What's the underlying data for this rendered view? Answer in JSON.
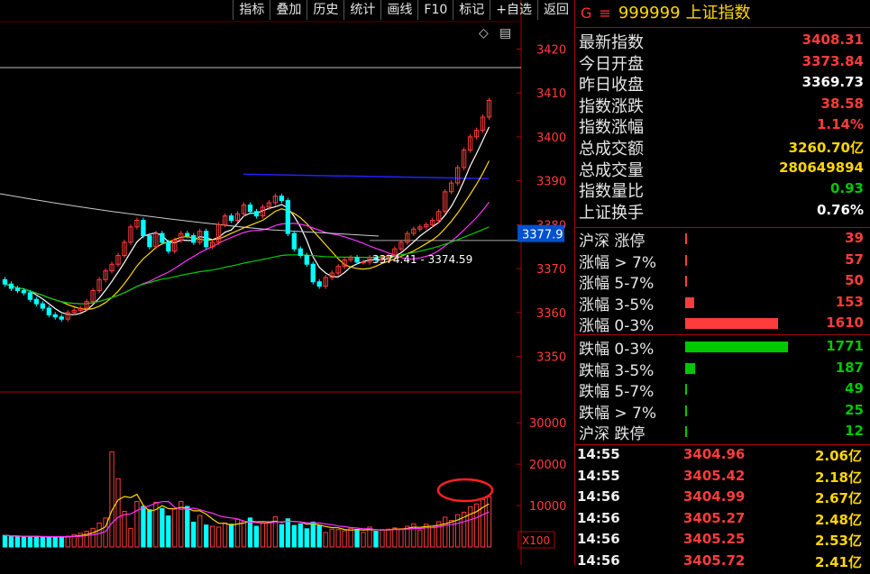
{
  "toolbar": [
    "指标",
    "叠加",
    "历史",
    "统计",
    "画线",
    "F10",
    "标记",
    "+自选",
    "返回"
  ],
  "colors": {
    "up": "#ff3c3c",
    "down": "#00ffff",
    "yellow": "#ffd700",
    "white": "#ffffff",
    "green": "#00c800",
    "border": "#b00000"
  },
  "icons": {
    "diamond": "◇",
    "menu": "▤"
  },
  "price_axis": {
    "ticks": [
      "3420",
      "3410",
      "3400",
      "3390",
      "3380",
      "3370",
      "3360",
      "3350"
    ],
    "current_price": "3377.9",
    "range_annotation": "3374.41 - 3374.59"
  },
  "volume_axis": {
    "ticks": [
      "30000",
      "20000",
      "10000"
    ],
    "unit": "X100"
  },
  "chart_data": {
    "type": "candlestick",
    "ylim": [
      3345,
      3425
    ],
    "open": [
      3367.5,
      3366.5,
      3365.5,
      3365.0,
      3364.5,
      3363.0,
      3362.0,
      3361.0,
      3359.5,
      3359.0,
      3358.5,
      3360.0,
      3360.5,
      3361.0,
      3362.5,
      3365.0,
      3367.5,
      3369.5,
      3371.0,
      3373.0,
      3376.0,
      3379.5,
      3381.0,
      3377.5,
      3375.0,
      3378.0,
      3376.0,
      3374.0,
      3376.5,
      3378.0,
      3377.5,
      3376.0,
      3378.5,
      3375.0,
      3376.0,
      3380.0,
      3382.0,
      3381.0,
      3382.5,
      3384.5,
      3383.0,
      3382.0,
      3384.0,
      3385.0,
      3386.5,
      3385.5,
      3378.0,
      3374.5,
      3373.0,
      3371.0,
      3367.0,
      3366.0,
      3368.0,
      3369.0,
      3370.5,
      3372.0,
      3372.5,
      3371.5,
      3371.5,
      3372.5,
      3372.0,
      3372.5,
      3373.0,
      3374.5,
      3376.0,
      3378.0,
      3379.0,
      3379.5,
      3380.0,
      3381.0,
      3383.0,
      3387.5,
      3389.5,
      3393.0,
      3397.0,
      3400.0,
      3401.5,
      3404.5
    ],
    "close": [
      3366.5,
      3365.5,
      3365.0,
      3364.5,
      3363.0,
      3362.0,
      3361.0,
      3359.5,
      3359.0,
      3358.5,
      3360.0,
      3360.5,
      3361.0,
      3362.5,
      3365.0,
      3367.5,
      3369.5,
      3371.0,
      3373.0,
      3376.0,
      3379.5,
      3381.0,
      3377.5,
      3375.0,
      3378.0,
      3376.0,
      3374.0,
      3376.5,
      3378.0,
      3377.5,
      3376.0,
      3378.5,
      3375.0,
      3376.0,
      3380.0,
      3382.0,
      3381.0,
      3382.5,
      3384.5,
      3383.0,
      3382.0,
      3384.0,
      3385.0,
      3386.5,
      3385.5,
      3378.0,
      3374.5,
      3373.0,
      3371.0,
      3367.0,
      3366.0,
      3368.0,
      3369.0,
      3370.5,
      3372.0,
      3372.5,
      3371.5,
      3371.5,
      3372.5,
      3372.0,
      3372.5,
      3373.0,
      3374.5,
      3376.0,
      3378.0,
      3379.0,
      3379.5,
      3380.0,
      3381.0,
      3383.0,
      3387.5,
      3389.5,
      3393.0,
      3397.0,
      3400.0,
      3401.5,
      3404.5,
      3408.3
    ],
    "volume": [
      2800,
      2600,
      2500,
      2400,
      2500,
      2600,
      2300,
      2400,
      2500,
      2400,
      2600,
      3000,
      3300,
      3800,
      4500,
      5800,
      7000,
      23000,
      16500,
      8600,
      4500,
      11000,
      9800,
      9000,
      10800,
      9300,
      7500,
      9300,
      11000,
      9800,
      6000,
      7600,
      5300,
      5000,
      4800,
      5800,
      5500,
      6700,
      6200,
      7000,
      5000,
      5800,
      6100,
      7300,
      5400,
      6800,
      5200,
      5600,
      4400,
      6000,
      5200,
      3500,
      4300,
      4200,
      3900,
      4500,
      4200,
      3500,
      4800,
      3800,
      4200,
      4300,
      4600,
      4400,
      5000,
      5600,
      4100,
      5500,
      5000,
      6100,
      7200,
      6400,
      7800,
      8400,
      9700,
      10400,
      11500,
      12100
    ]
  },
  "stock": {
    "g": "G",
    "menu_icon": "≡",
    "code": "999999",
    "name": "上证指数"
  },
  "stats": [
    {
      "label": "最新指数",
      "value": "3408.31",
      "color": "#ff3c3c"
    },
    {
      "label": "今日开盘",
      "value": "3373.84",
      "color": "#ff3c3c"
    },
    {
      "label": "昨日收盘",
      "value": "3369.73",
      "color": "#ffffff"
    },
    {
      "label": "指数涨跌",
      "value": "38.58",
      "color": "#ff3c3c"
    },
    {
      "label": "指数涨幅",
      "value": "1.14%",
      "color": "#ff3c3c"
    },
    {
      "label": "总成交额",
      "value": "3260.70亿",
      "color": "#ffd700"
    },
    {
      "label": "总成交量",
      "value": "280649894",
      "color": "#ffd700"
    },
    {
      "label": "指数量比",
      "value": "0.93",
      "color": "#00c800"
    },
    {
      "label": "上证换手",
      "value": "0.76%",
      "color": "#ffffff"
    }
  ],
  "breadth_up": [
    {
      "label": "沪深 涨停",
      "value": "39",
      "fraction": 0.0,
      "color": "#ff3c3c"
    },
    {
      "label": "涨幅 > 7%",
      "value": "57",
      "fraction": 0.01,
      "color": "#ff3c3c"
    },
    {
      "label": "涨幅 5-7%",
      "value": "50",
      "fraction": 0.01,
      "color": "#ff3c3c"
    },
    {
      "label": "涨幅 3-5%",
      "value": "153",
      "fraction": 0.05,
      "color": "#ff3c3c"
    },
    {
      "label": "涨幅 0-3%",
      "value": "1610",
      "fraction": 0.54,
      "color": "#ff3c3c"
    }
  ],
  "breadth_down": [
    {
      "label": "跌幅 0-3%",
      "value": "1771",
      "fraction": 0.6,
      "color": "#00c800"
    },
    {
      "label": "跌幅 3-5%",
      "value": "187",
      "fraction": 0.06,
      "color": "#00c800"
    },
    {
      "label": "跌幅 5-7%",
      "value": "49",
      "fraction": 0.01,
      "color": "#00c800"
    },
    {
      "label": "跌幅 > 7%",
      "value": "25",
      "fraction": 0.0,
      "color": "#00c800"
    },
    {
      "label": "沪深 跌停",
      "value": "12",
      "fraction": 0.0,
      "color": "#00c800"
    }
  ],
  "ticks": [
    {
      "time": "14:55",
      "price": "3404.96",
      "vol": "2.06亿"
    },
    {
      "time": "14:55",
      "price": "3405.42",
      "vol": "2.18亿"
    },
    {
      "time": "14:56",
      "price": "3404.99",
      "vol": "2.67亿"
    },
    {
      "time": "14:56",
      "price": "3405.27",
      "vol": "2.48亿"
    },
    {
      "time": "14:56",
      "price": "3405.25",
      "vol": "2.53亿"
    },
    {
      "time": "14:56",
      "price": "3405.72",
      "vol": "2.41亿"
    }
  ]
}
